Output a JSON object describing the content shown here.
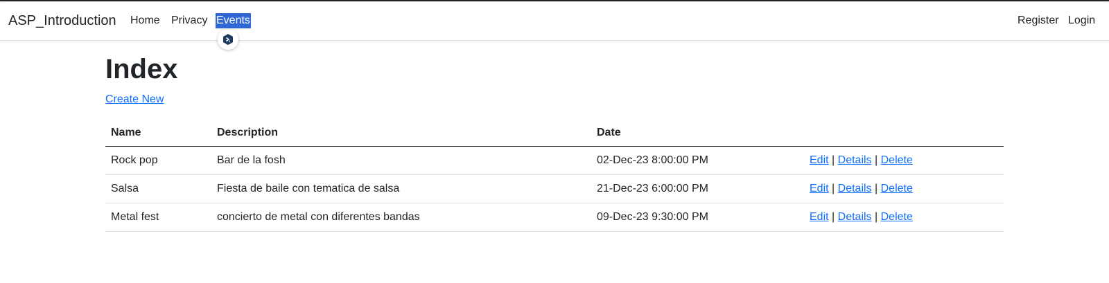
{
  "navbar": {
    "brand": "ASP_Introduction",
    "links": [
      {
        "label": "Home"
      },
      {
        "label": "Privacy"
      },
      {
        "label": "Events"
      }
    ],
    "right_links": [
      {
        "label": "Register"
      },
      {
        "label": "Login"
      }
    ]
  },
  "overlay": {
    "icon": "extension-badge-icon"
  },
  "main": {
    "title": "Index",
    "create_link": "Create New",
    "table": {
      "headers": [
        "Name",
        "Description",
        "Date",
        ""
      ],
      "rows": [
        {
          "name": "Rock pop",
          "description": "Bar de la fosh",
          "date": "02-Dec-23 8:00:00 PM"
        },
        {
          "name": "Salsa",
          "description": "Fiesta de baile con tematica de salsa",
          "date": "21-Dec-23 6:00:00 PM"
        },
        {
          "name": "Metal fest",
          "description": "concierto de metal con diferentes bandas",
          "date": "09-Dec-23 9:30:00 PM"
        }
      ],
      "actions": {
        "edit": "Edit",
        "details": "Details",
        "delete": "Delete",
        "separator": "|"
      }
    }
  },
  "colors": {
    "link": "#0d6efd",
    "selection": "#2f67d6",
    "text": "#212529"
  }
}
